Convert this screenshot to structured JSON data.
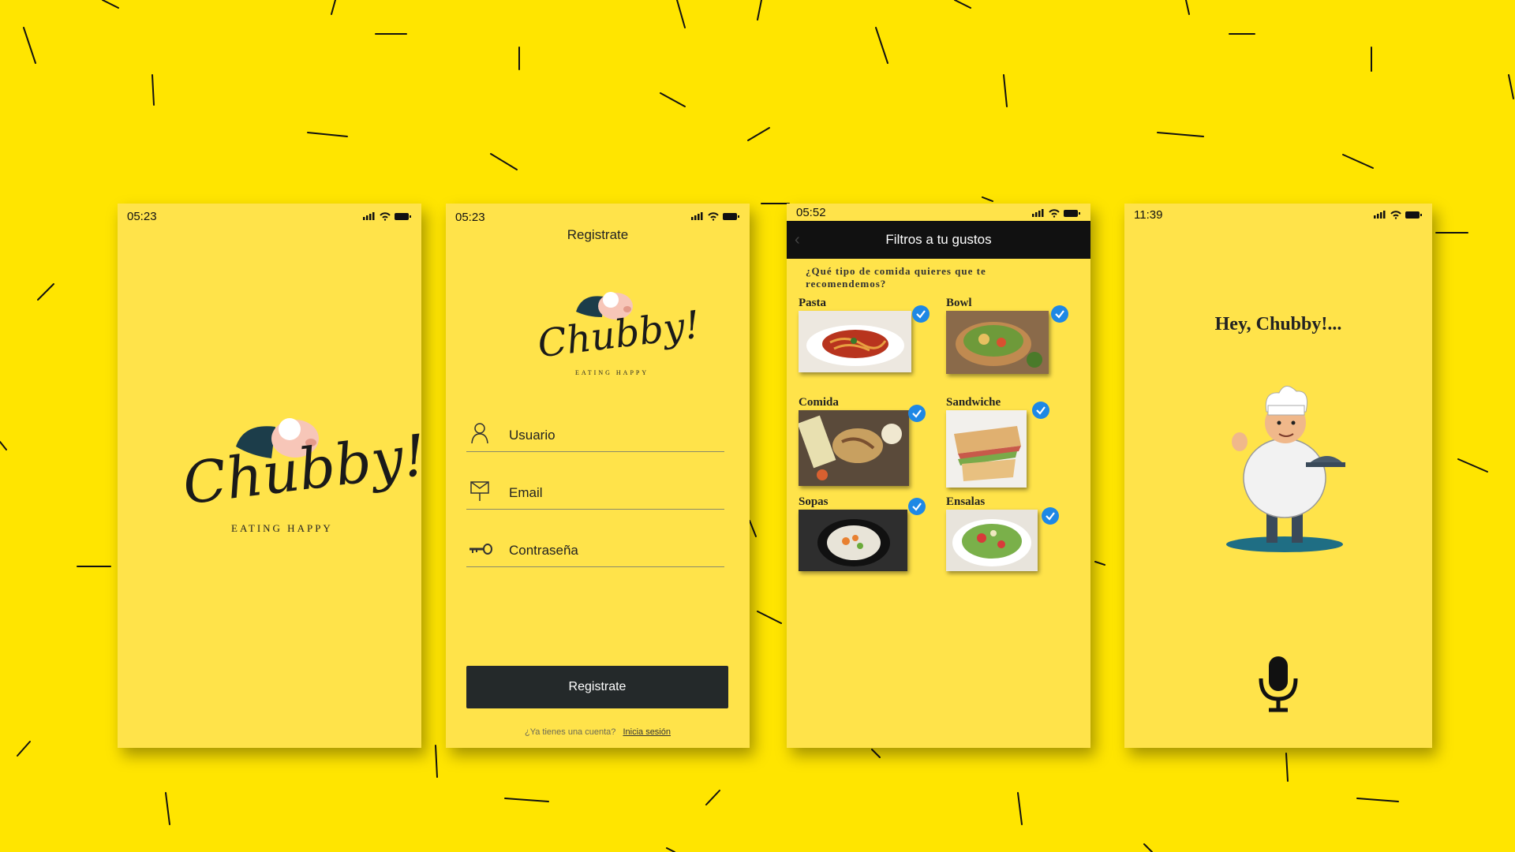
{
  "colors": {
    "background": "#FFE500",
    "screen": "#FFE34A",
    "dark": "#24292A",
    "check": "#1E88E5"
  },
  "splash": {
    "time": "05:23",
    "logo_text": "Chubby!",
    "tagline": "EATING HAPPY"
  },
  "register": {
    "time": "05:23",
    "title": "Registrate",
    "logo_text": "Chubby!",
    "tagline": "EATING HAPPY",
    "fields": [
      {
        "label": "Usuario",
        "icon": "user-icon"
      },
      {
        "label": "Email",
        "icon": "email-icon"
      },
      {
        "label": "Contraseña",
        "icon": "key-icon"
      }
    ],
    "button_label": "Registrate",
    "login_prompt": "¿Ya tienes una cuenta?",
    "login_link": "Inicia sesión"
  },
  "filters": {
    "time": "05:52",
    "title": "Filtros a tu gustos",
    "question": "¿Qué tipo de comida quieres que te recomendemos?",
    "foods": [
      {
        "name": "Pasta",
        "checked": true
      },
      {
        "name": "Bowl",
        "checked": true
      },
      {
        "name": "Comida",
        "checked": true
      },
      {
        "name": "Sandwiche",
        "checked": true
      },
      {
        "name": "Sopas",
        "checked": true
      },
      {
        "name": "Ensalas",
        "checked": true
      }
    ]
  },
  "assistant": {
    "time": "11:39",
    "greeting": "Hey, Chubby!...",
    "mic_icon": "microphone-icon",
    "mascot": "chef-mascot"
  }
}
